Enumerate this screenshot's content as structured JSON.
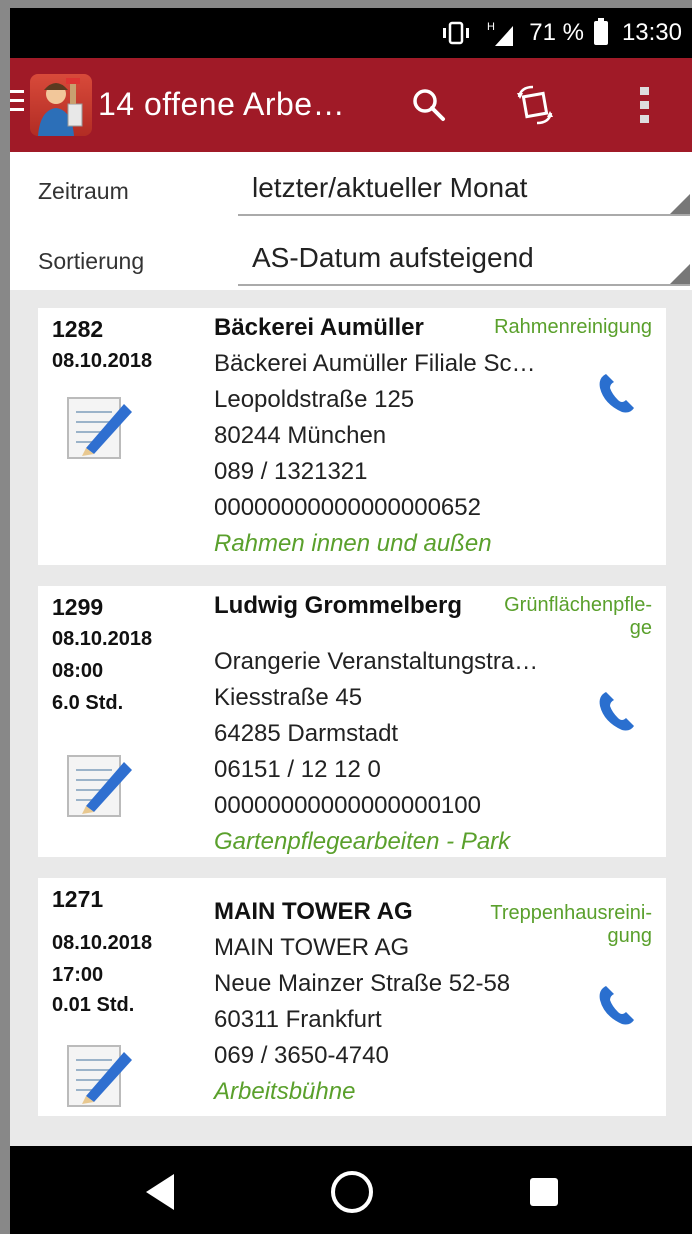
{
  "status_bar": {
    "battery": "71 %",
    "time": "13:30",
    "network": "H"
  },
  "app_bar": {
    "title": "14  offene Arbe…"
  },
  "filters": {
    "period_label": "Zeitraum",
    "period_value": "letzter/aktueller Monat",
    "sort_label": "Sortierung",
    "sort_value": "AS-Datum aufsteigend"
  },
  "jobs": [
    {
      "id": "1282",
      "date": "08.10.2018",
      "time": "",
      "duration": "",
      "customer": "Bäckerei Aumüller",
      "category": "Rahmenreinigung",
      "site": "Bäckerei Aumüller Filiale Sc…",
      "street": "Leopoldstraße 125",
      "city": "80244 München",
      "phone": "089 / 1321321",
      "number": "00000000000000000652",
      "note": "Rahmen  innen und außen"
    },
    {
      "id": "1299",
      "date": "08.10.2018",
      "time": "08:00",
      "duration": "6.0 Std.",
      "customer": "Ludwig Grommelberg",
      "category_line1": "Grünflächenpfle-",
      "category_line2": "ge",
      "site": "Orangerie Veranstaltungstra…",
      "street": "Kiesstraße 45",
      "city": "64285 Darmstadt",
      "phone": "06151 / 12 12 0",
      "number": "00000000000000000100",
      "note": "Gartenpflegearbeiten - Park"
    },
    {
      "id": "1271",
      "date": "08.10.2018",
      "time": "17:00",
      "duration": "0.01 Std.",
      "customer": "MAIN  TOWER AG",
      "category_line1": "Treppenhausreini-",
      "category_line2": "gung",
      "site": "MAIN  TOWER AG",
      "street": "Neue Mainzer Straße 52-58",
      "city": "60311 Frankfurt",
      "phone": "069 / 3650-4740",
      "note": "Arbeitsbühne"
    }
  ],
  "colors": {
    "app_bar": "#a01a27",
    "accent_green": "#5aa02c",
    "phone_blue": "#2a6fcf"
  },
  "icons": [
    "menu-icon",
    "app-logo-icon",
    "search-icon",
    "rotate-screen-icon",
    "more-vert-icon",
    "phone-icon",
    "edit-note-icon",
    "back-icon",
    "home-icon",
    "recents-icon"
  ]
}
